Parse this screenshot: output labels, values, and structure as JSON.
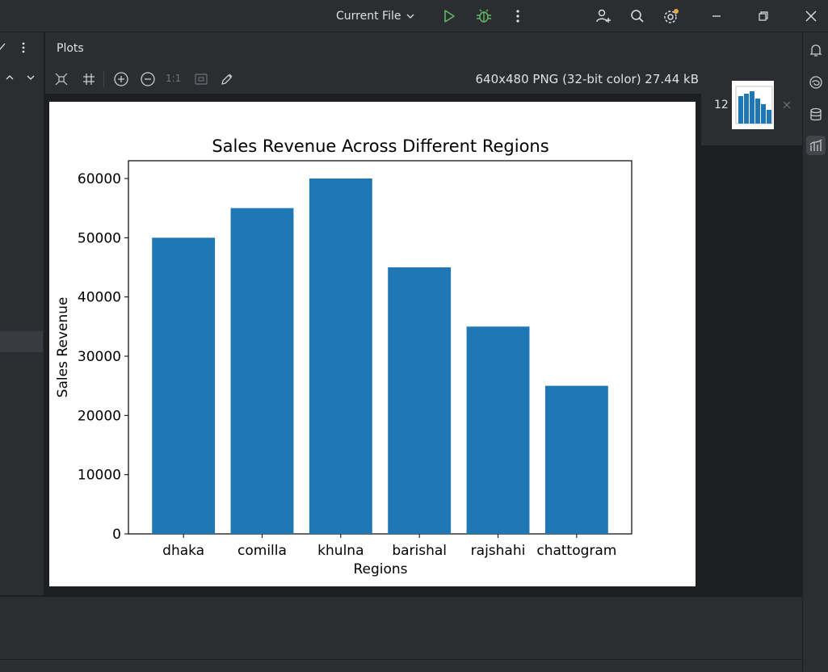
{
  "titlebar": {
    "run_config_label": "Current File",
    "icons": [
      "chevron-down-icon",
      "run-icon",
      "debug-icon",
      "more-vertical-icon",
      "add-user-icon",
      "search-icon",
      "settings-icon",
      "minimize-icon",
      "restore-icon",
      "close-icon"
    ],
    "colors": {
      "run": "#5fb865",
      "debug": "#5fb865",
      "notification_dot": "#e5a84b"
    }
  },
  "plots": {
    "title": "Plots",
    "image_info": "640x480 PNG (32-bit color) 27.44 kB",
    "zoom_label": "1:1",
    "toolbar_icons": [
      "fit-icon",
      "grid-icon",
      "zoom-in-icon",
      "zoom-out-icon",
      "actual-size-icon",
      "fit-zoom-icon",
      "color-picker-icon"
    ]
  },
  "thumbnails": [
    {
      "index_label": "12"
    }
  ],
  "right_strip_icons": [
    "notifications-icon",
    "ai-assistant-icon",
    "database-icon",
    "plots-icon"
  ],
  "chart_data": {
    "type": "bar",
    "title": "Sales Revenue Across Different Regions",
    "xlabel": "Regions",
    "ylabel": "Sales Revenue",
    "categories": [
      "dhaka",
      "comilla",
      "khulna",
      "barishal",
      "rajshahi",
      "chattogram"
    ],
    "values": [
      50000,
      55000,
      60000,
      45000,
      35000,
      25000
    ],
    "ylim": [
      0,
      63000
    ],
    "yticks": [
      "0",
      "10000",
      "20000",
      "30000",
      "40000",
      "50000",
      "60000"
    ],
    "ytick_values": [
      0,
      10000,
      20000,
      30000,
      40000,
      50000,
      60000
    ],
    "bar_color": "#1f77b4",
    "grid": false
  }
}
